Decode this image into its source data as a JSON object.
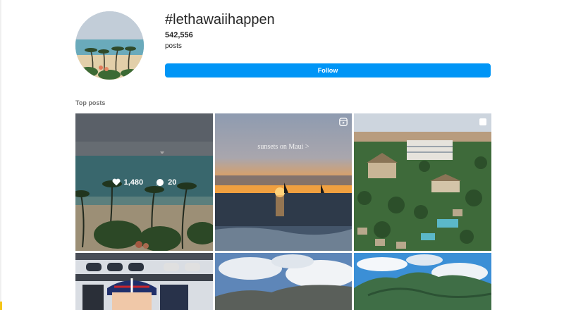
{
  "header": {
    "hashtag": "#lethawaiihappen",
    "post_count": "542,556",
    "post_count_label": "posts",
    "follow_label": "Follow"
  },
  "section": {
    "title": "Top posts"
  },
  "posts": [
    {
      "likes": "1,480",
      "comments": "20",
      "hovered": true
    },
    {
      "caption": "sunsets on Maui >",
      "type": "reel"
    },
    {
      "type": "carousel"
    },
    {},
    {},
    {}
  ],
  "colors": {
    "accent": "#0095f6",
    "text": "#262626",
    "muted": "#737373"
  }
}
